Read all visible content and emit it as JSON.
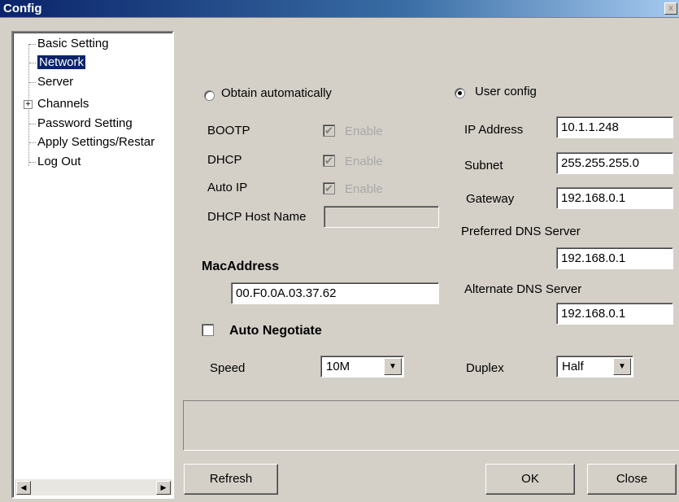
{
  "window": {
    "title": "Config",
    "close_glyph": "x"
  },
  "tree": {
    "items": [
      {
        "label": "Basic Setting",
        "selected": false
      },
      {
        "label": "Network",
        "selected": true
      },
      {
        "label": "Server",
        "selected": false
      },
      {
        "label": "Channels",
        "selected": false,
        "expander": "+"
      },
      {
        "label": "Password Setting",
        "selected": false
      },
      {
        "label": "Apply Settings/Restar",
        "selected": false
      },
      {
        "label": "Log Out",
        "selected": false
      }
    ],
    "scroll_left_icon": "arrow-left-icon",
    "scroll_right_icon": "arrow-right-icon"
  },
  "network": {
    "obtain_auto": {
      "label": "Obtain automatically",
      "selected": false
    },
    "user_config": {
      "label": "User config",
      "selected": true
    },
    "bootp": {
      "label": "BOOTP",
      "checkbox_label": "Enable",
      "checked": true,
      "disabled": true
    },
    "dhcp": {
      "label": "DHCP",
      "checkbox_label": "Enable",
      "checked": true,
      "disabled": true
    },
    "auto_ip": {
      "label": "Auto IP",
      "checkbox_label": "Enable",
      "checked": true,
      "disabled": true
    },
    "dhcp_host_name": {
      "label": "DHCP Host Name",
      "value": ""
    },
    "ip_address": {
      "label": "IP Address",
      "value": "10.1.1.248"
    },
    "subnet": {
      "label": "Subnet",
      "value": "255.255.255.0"
    },
    "gateway": {
      "label": "Gateway",
      "value": "192.168.0.1"
    },
    "preferred_dns": {
      "label": "Preferred DNS Server",
      "value": "192.168.0.1"
    },
    "alternate_dns": {
      "label": "Alternate DNS Server",
      "value": "192.168.0.1"
    },
    "mac_address": {
      "label": "MacAddress",
      "value": "00.F0.0A.03.37.62"
    },
    "auto_negotiate": {
      "label": "Auto Negotiate",
      "checked": false
    },
    "speed": {
      "label": "Speed",
      "value": "10M"
    },
    "duplex": {
      "label": "Duplex",
      "value": "Half"
    }
  },
  "buttons": {
    "refresh": "Refresh",
    "ok": "OK",
    "close": "Close"
  },
  "glyphs": {
    "check": "✔",
    "dropdown": "▼",
    "left": "◀",
    "right": "▶"
  }
}
